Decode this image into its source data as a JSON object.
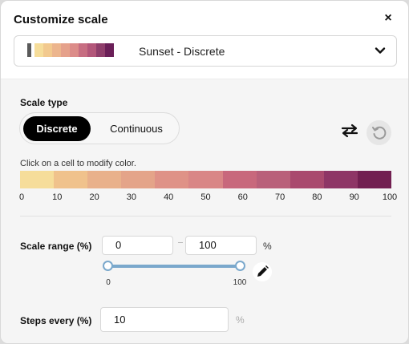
{
  "dialog": {
    "title": "Customize scale",
    "close_label": "×"
  },
  "scale_select": {
    "name": "Sunset - Discrete",
    "preview_colors": [
      "#5a5a5a",
      "#f6dd9a",
      "#f2c98e",
      "#ecb58d",
      "#e5a18b",
      "#dc8c89",
      "#c76e82",
      "#b3577a",
      "#8f3e6b",
      "#6b1f58"
    ]
  },
  "scale_type": {
    "label": "Scale type",
    "options": [
      "Discrete",
      "Continuous"
    ],
    "selected": "Discrete"
  },
  "color_bar": {
    "hint": "Click on a cell to modify color.",
    "cells": [
      "#f6dd9a",
      "#f0c28c",
      "#e9b18b",
      "#e4a489",
      "#df9287",
      "#d98686",
      "#c8687c",
      "#b9607a",
      "#a9496e",
      "#8e3566",
      "#721f51"
    ],
    "ticks": [
      "0",
      "10",
      "20",
      "30",
      "40",
      "50",
      "60",
      "70",
      "80",
      "90",
      "100"
    ]
  },
  "scale_range": {
    "label": "Scale range (%)",
    "min_value": "0",
    "max_value": "100",
    "unit": "%",
    "slider_min_label": "0",
    "slider_max_label": "100"
  },
  "steps": {
    "label": "Steps every (%)",
    "value": "10",
    "unit": "%"
  }
}
